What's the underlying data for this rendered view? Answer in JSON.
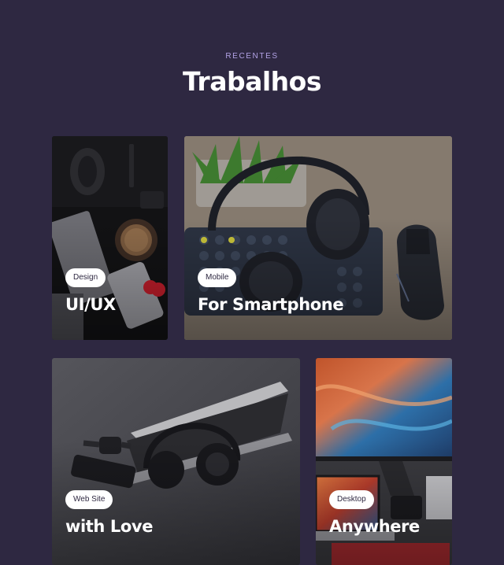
{
  "section": {
    "eyebrow": "RECENTES",
    "title": "Trabalhos"
  },
  "cards": [
    {
      "tag": "Design",
      "title": "UI/UX",
      "image": "desk-flatlay-photo"
    },
    {
      "tag": "Mobile",
      "title": "For Smartphone",
      "image": "headphones-keyboard-photo"
    },
    {
      "tag": "Web Site",
      "title": "with Love",
      "image": "laptop-headphones-photo"
    },
    {
      "tag": "Desktop",
      "title": "Anywhere",
      "image": "desktop-monitor-photo"
    }
  ],
  "colors": {
    "background": "#2e2841",
    "eyebrow": "#b3a3e6",
    "pill_bg": "#ffffff",
    "title_text": "#ffffff"
  }
}
